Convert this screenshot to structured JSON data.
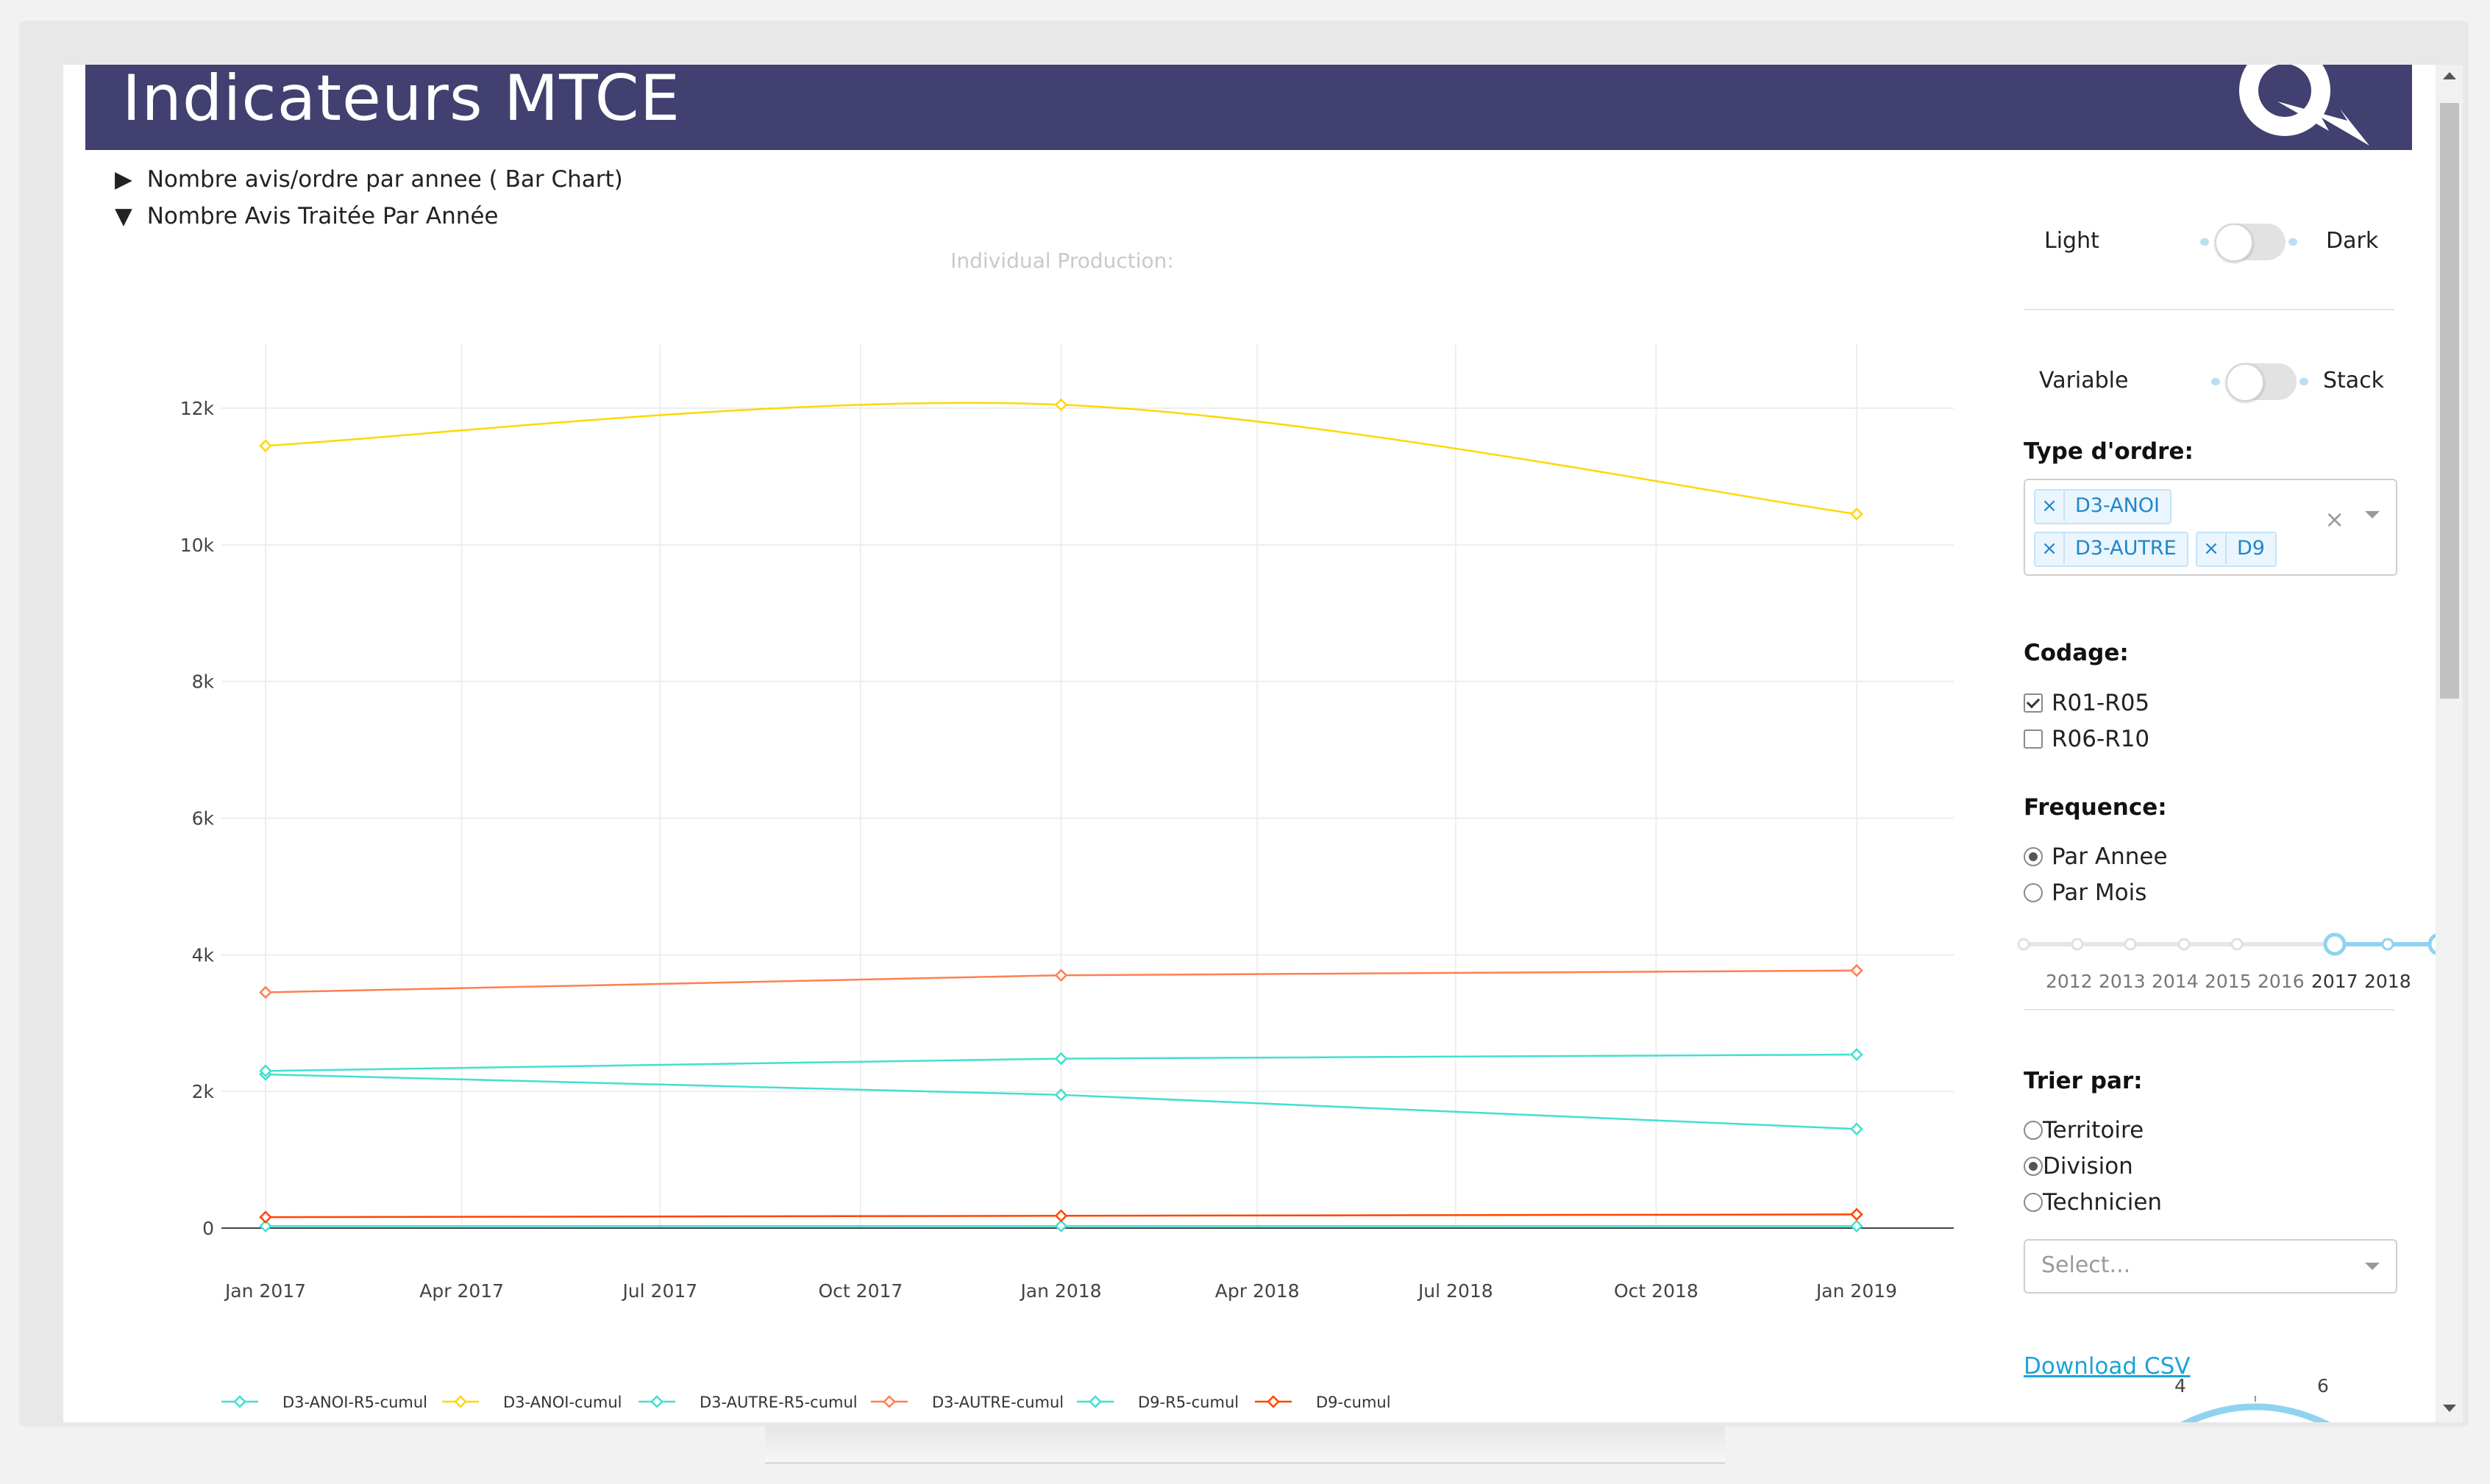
{
  "header": {
    "title": "Indicateurs MTCE"
  },
  "sections": [
    {
      "marker": "▶",
      "label": "Nombre avis/ordre par annee ( Bar Chart)"
    },
    {
      "marker": "▼",
      "label": "Nombre Avis Traitée Par Année"
    }
  ],
  "chart_data": {
    "type": "line",
    "title": "Individual Production:",
    "xlabel": "",
    "ylabel": "",
    "x": [
      "2017-01-01",
      "2018-01-01",
      "2019-01-01"
    ],
    "x_ticks": [
      "Jan 2017",
      "Apr 2017",
      "Jul 2017",
      "Oct 2017",
      "Jan 2018",
      "Apr 2018",
      "Jul 2018",
      "Oct 2018",
      "Jan 2019"
    ],
    "y_ticks": [
      "0",
      "2k",
      "4k",
      "6k",
      "8k",
      "10k",
      "12k"
    ],
    "ylim": [
      0,
      12000
    ],
    "grid": true,
    "legend_position": "bottom",
    "series": [
      {
        "name": "D3-ANOI-R5-cumul",
        "color": "#40e0d0",
        "values": [
          30,
          30,
          30
        ],
        "smooth": false
      },
      {
        "name": "D3-ANOI-cumul",
        "color": "#ffd700",
        "values": [
          11450,
          12050,
          10450
        ],
        "smooth": true
      },
      {
        "name": "D3-AUTRE-R5-cumul",
        "color": "#40e0d0",
        "values": [
          2250,
          1950,
          1450
        ],
        "smooth": false
      },
      {
        "name": "D3-AUTRE-cumul",
        "color": "#ff7f50",
        "values": [
          3450,
          3700,
          3770
        ],
        "smooth": false
      },
      {
        "name": "D9-R5-cumul",
        "color": "#40e0d0",
        "values": [
          2300,
          2480,
          2540
        ],
        "smooth": false
      },
      {
        "name": "D9-cumul",
        "color": "#ff4500",
        "values": [
          160,
          180,
          200
        ],
        "smooth": false
      }
    ]
  },
  "panel": {
    "theme_toggle": {
      "left": "Light",
      "right": "Dark"
    },
    "mode_toggle": {
      "left": "Variable",
      "right": "Stack"
    },
    "type_ordre": {
      "label": "Type d'ordre:",
      "tags": [
        "D3-ANOI",
        "D3-AUTRE",
        "D9"
      ],
      "remove_glyph": "×",
      "clear_glyph": "×"
    },
    "codage": {
      "label": "Codage:",
      "options": [
        {
          "label": "R01-R05",
          "checked": true
        },
        {
          "label": "R06-R10",
          "checked": false
        }
      ]
    },
    "frequence": {
      "label": "Frequence:",
      "options": [
        {
          "label": "Par Annee",
          "checked": true
        },
        {
          "label": "Par Mois",
          "checked": false
        }
      ]
    },
    "year_slider": {
      "labels": [
        "2012",
        "2013",
        "2014",
        "2015",
        "2016",
        "2017",
        "2018"
      ],
      "range": [
        "2017",
        "2019"
      ],
      "accent": "#8fd3f0"
    },
    "trier_par": {
      "label": "Trier par:",
      "options": [
        {
          "label": "Territoire",
          "checked": false
        },
        {
          "label": "Division",
          "checked": true
        },
        {
          "label": "Technicien",
          "checked": false
        }
      ]
    },
    "select": {
      "placeholder": "Select..."
    },
    "download": {
      "label": "Download CSV"
    },
    "gauge": {
      "labels": [
        "4",
        "6"
      ]
    }
  }
}
